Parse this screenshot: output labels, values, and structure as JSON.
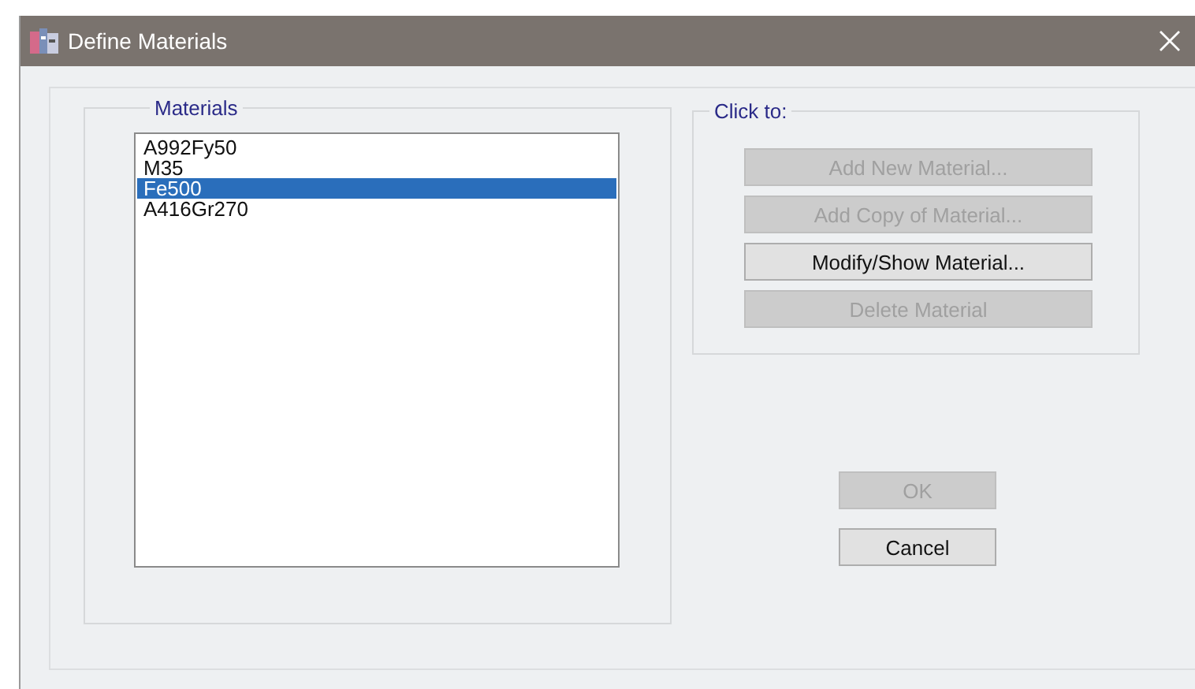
{
  "window": {
    "title": "Define Materials"
  },
  "materials": {
    "label": "Materials",
    "items": [
      {
        "name": "A992Fy50",
        "selected": false
      },
      {
        "name": "M35",
        "selected": false
      },
      {
        "name": "Fe500",
        "selected": true
      },
      {
        "name": "A416Gr270",
        "selected": false
      }
    ]
  },
  "click_to": {
    "label": "Click to:",
    "buttons": [
      {
        "label": "Add New Material...",
        "disabled": true
      },
      {
        "label": "Add Copy of Material...",
        "disabled": true
      },
      {
        "label": "Modify/Show Material...",
        "disabled": false
      },
      {
        "label": "Delete Material",
        "disabled": true
      }
    ]
  },
  "dialog_buttons": [
    {
      "label": "OK",
      "disabled": true
    },
    {
      "label": "Cancel",
      "disabled": false
    }
  ]
}
